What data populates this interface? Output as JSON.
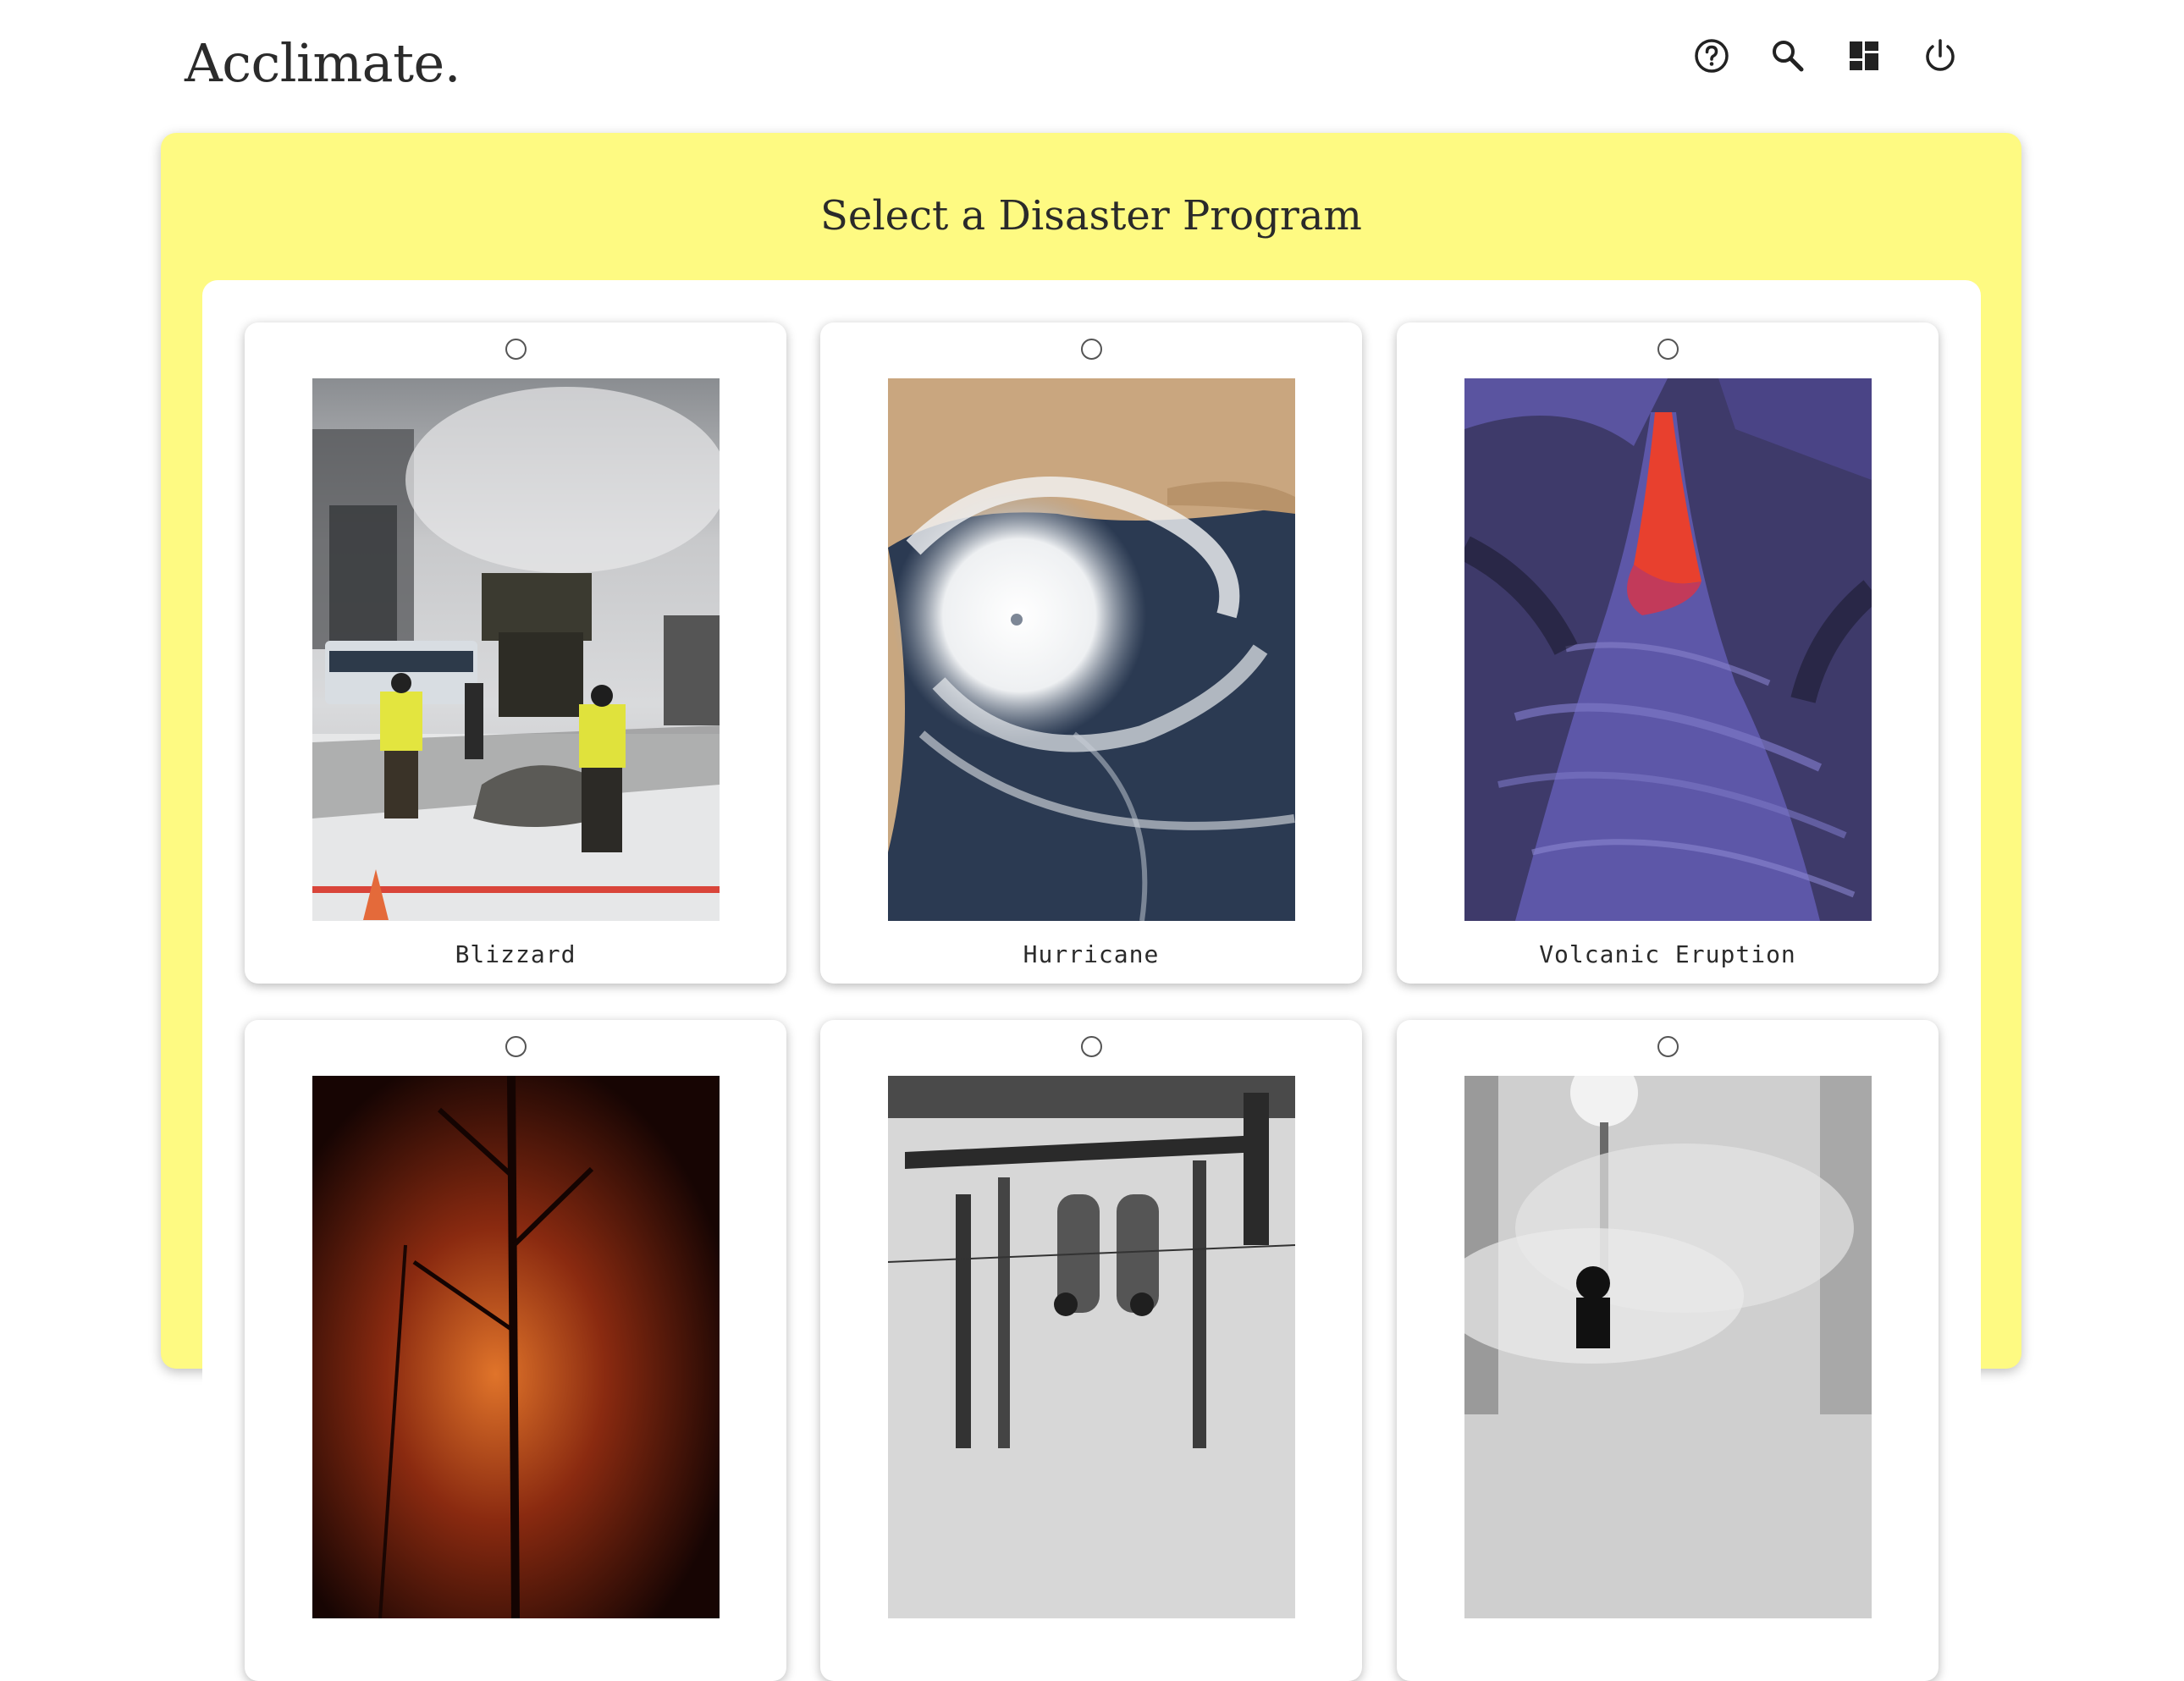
{
  "app": {
    "brand": "Acclimate."
  },
  "header": {
    "icons": [
      {
        "name": "help-icon"
      },
      {
        "name": "search-icon"
      },
      {
        "name": "dashboard-icon"
      },
      {
        "name": "power-icon"
      }
    ]
  },
  "main": {
    "title": "Select a Disaster Program",
    "programs": [
      {
        "label": "Blizzard",
        "selected": false,
        "image": "blizzard-photo"
      },
      {
        "label": "Hurricane",
        "selected": false,
        "image": "hurricane-satellite-photo"
      },
      {
        "label": "Volcanic Eruption",
        "selected": false,
        "image": "lava-flow-photo"
      },
      {
        "label": "",
        "selected": false,
        "image": "wildfire-photo"
      },
      {
        "label": "",
        "selected": false,
        "image": "industrial-plant-photo"
      },
      {
        "label": "",
        "selected": false,
        "image": "smoke-firefighter-photo"
      }
    ]
  },
  "colors": {
    "panel": "#fefa82",
    "card": "#ffffff",
    "text": "#2a2a2a"
  }
}
